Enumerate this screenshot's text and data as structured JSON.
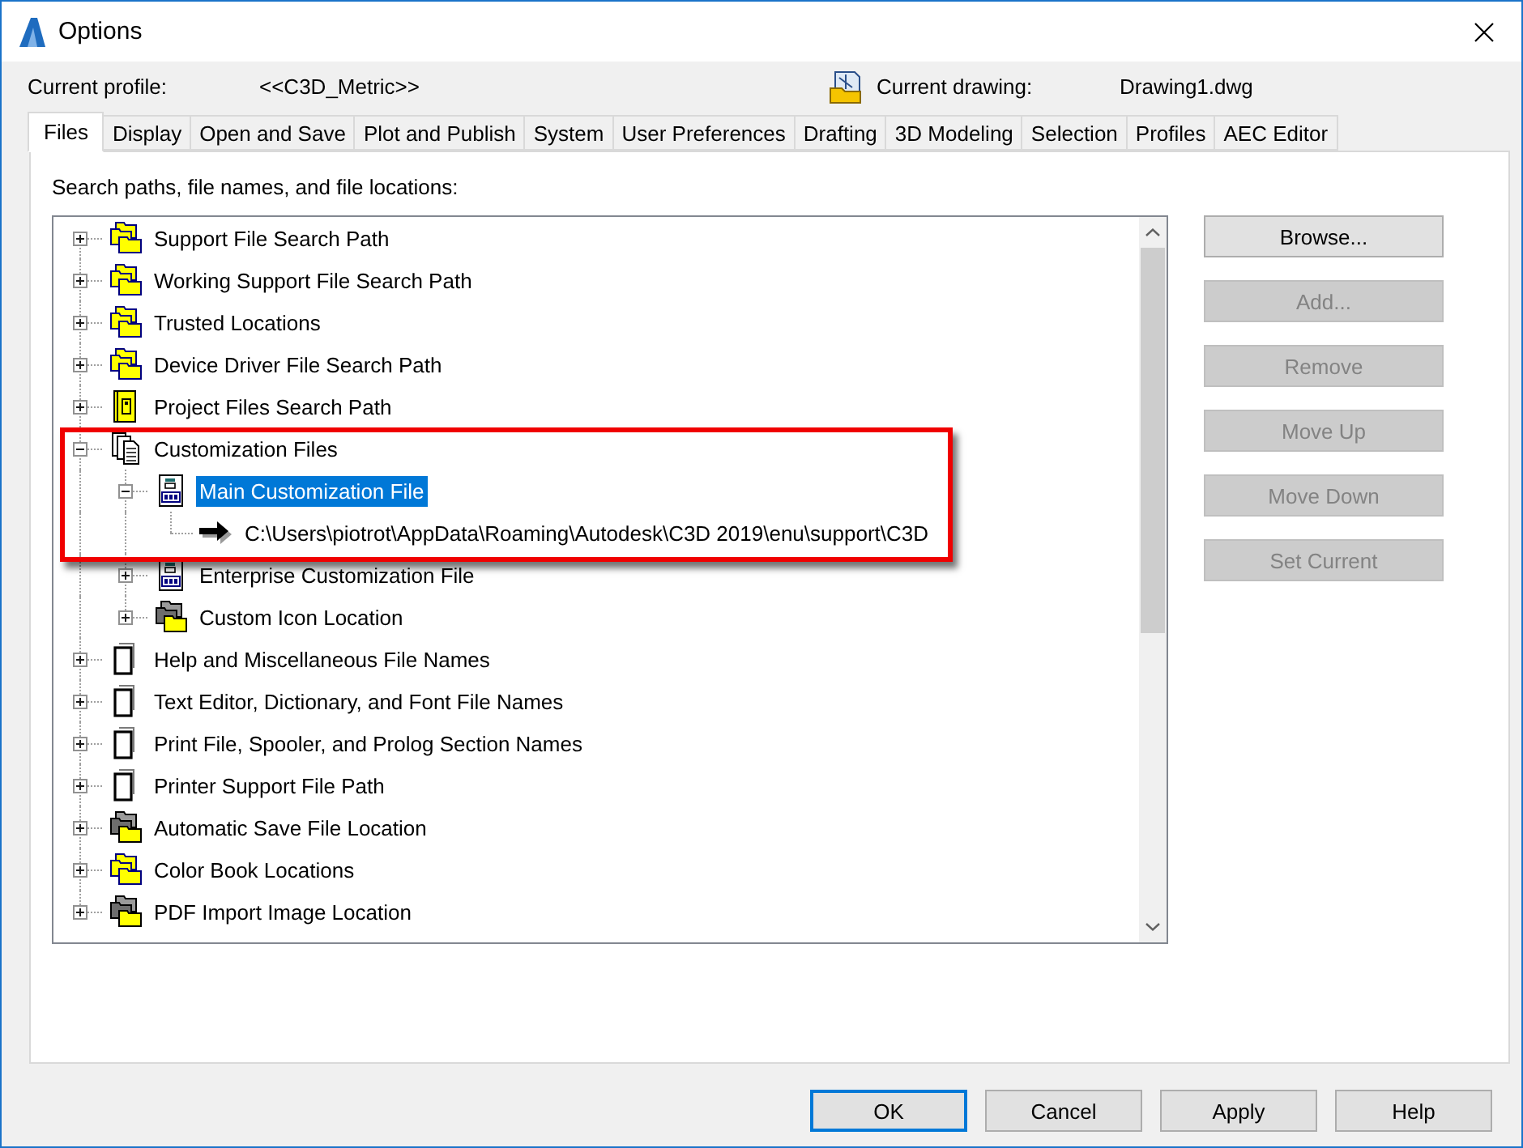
{
  "window": {
    "title": "Options"
  },
  "profile": {
    "label": "Current profile:",
    "value": "<<C3D_Metric>>"
  },
  "drawing": {
    "label": "Current drawing:",
    "value": "Drawing1.dwg"
  },
  "tabs": [
    {
      "label": "Files",
      "selected": true
    },
    {
      "label": "Display",
      "selected": false
    },
    {
      "label": "Open and Save",
      "selected": false
    },
    {
      "label": "Plot and Publish",
      "selected": false
    },
    {
      "label": "System",
      "selected": false
    },
    {
      "label": "User Preferences",
      "selected": false
    },
    {
      "label": "Drafting",
      "selected": false
    },
    {
      "label": "3D Modeling",
      "selected": false
    },
    {
      "label": "Selection",
      "selected": false
    },
    {
      "label": "Profiles",
      "selected": false
    },
    {
      "label": "AEC Editor",
      "selected": false
    }
  ],
  "files_tab": {
    "caption": "Search paths, file names, and file locations:",
    "tree": {
      "items": [
        {
          "label": "Support File Search Path",
          "kind": "folders",
          "expanded": false,
          "selected": false,
          "highlighted": false
        },
        {
          "label": "Working Support File Search Path",
          "kind": "folders",
          "expanded": false,
          "selected": false,
          "highlighted": false
        },
        {
          "label": "Trusted Locations",
          "kind": "folders",
          "expanded": false,
          "selected": false,
          "highlighted": false
        },
        {
          "label": "Device Driver File Search Path",
          "kind": "folders",
          "expanded": false,
          "selected": false,
          "highlighted": false
        },
        {
          "label": "Project Files Search Path",
          "kind": "binder",
          "expanded": false,
          "selected": false,
          "highlighted": false
        },
        {
          "label": "Customization Files",
          "kind": "documents",
          "expanded": true,
          "selected": false,
          "highlighted": true,
          "children": [
            {
              "label": "Main Customization File",
              "kind": "cuifile",
              "expanded": true,
              "selected": true,
              "highlighted": true,
              "children": [
                {
                  "label": "C:\\Users\\piotrot\\AppData\\Roaming\\Autodesk\\C3D 2019\\enu\\support\\C3D",
                  "kind": "arrow",
                  "selected": false,
                  "highlighted": true
                }
              ]
            },
            {
              "label": "Enterprise Customization File",
              "kind": "cuifile",
              "expanded": false,
              "selected": false,
              "highlighted": false
            },
            {
              "label": "Custom Icon Location",
              "kind": "grayfolders",
              "expanded": false,
              "selected": false,
              "highlighted": false
            }
          ]
        },
        {
          "label": "Help and Miscellaneous File Names",
          "kind": "page",
          "expanded": false,
          "selected": false,
          "highlighted": false
        },
        {
          "label": "Text Editor, Dictionary, and Font File Names",
          "kind": "page",
          "expanded": false,
          "selected": false,
          "highlighted": false
        },
        {
          "label": "Print File, Spooler, and Prolog Section Names",
          "kind": "page",
          "expanded": false,
          "selected": false,
          "highlighted": false
        },
        {
          "label": "Printer Support File Path",
          "kind": "page",
          "expanded": false,
          "selected": false,
          "highlighted": false
        },
        {
          "label": "Automatic Save File Location",
          "kind": "grayfolders",
          "expanded": false,
          "selected": false,
          "highlighted": false
        },
        {
          "label": "Color Book Locations",
          "kind": "folders",
          "expanded": false,
          "selected": false,
          "highlighted": false
        },
        {
          "label": "PDF Import Image Location",
          "kind": "grayfolders",
          "expanded": false,
          "selected": false,
          "highlighted": false
        }
      ]
    },
    "buttons": [
      {
        "label": "Browse...",
        "disabled": false
      },
      {
        "label": "Add...",
        "disabled": true
      },
      {
        "label": "Remove",
        "disabled": true
      },
      {
        "label": "Move Up",
        "disabled": true
      },
      {
        "label": "Move Down",
        "disabled": true
      },
      {
        "label": "Set Current",
        "disabled": true
      }
    ]
  },
  "footer_buttons": [
    {
      "label": "OK",
      "default": true
    },
    {
      "label": "Cancel",
      "default": false
    },
    {
      "label": "Apply",
      "default": false
    },
    {
      "label": "Help",
      "default": false
    }
  ]
}
